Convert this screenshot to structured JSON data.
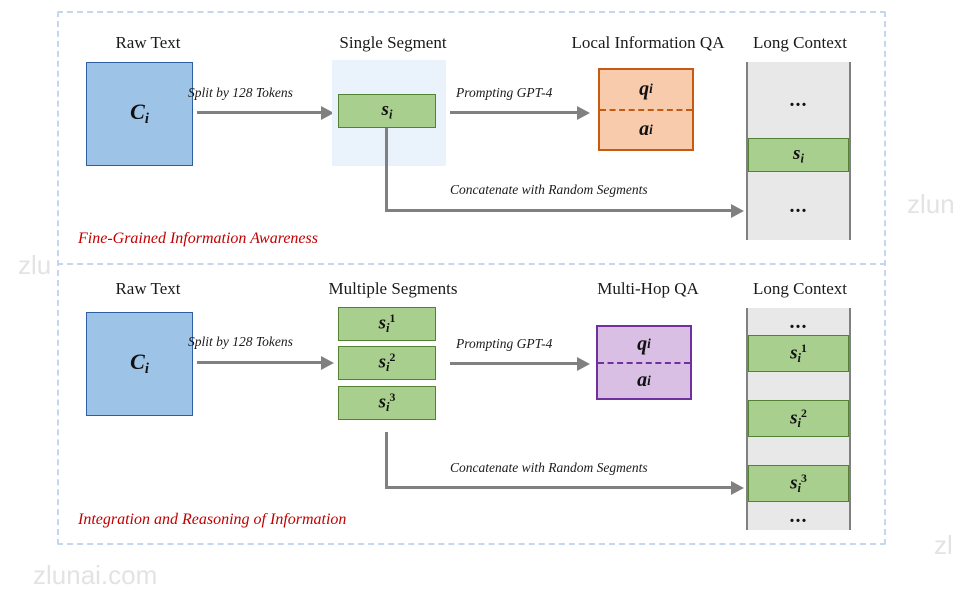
{
  "figure": {
    "panels": [
      {
        "id": "top",
        "caption": "Fine-Grained Information Awareness",
        "columns": {
          "raw_text_title": "Raw Text",
          "segment_title": "Single Segment",
          "qa_title": "Local Information QA",
          "context_title": "Long Context"
        },
        "raw_text_label": "C",
        "raw_text_sub": "i",
        "segments": [
          {
            "base": "s",
            "sub": "i",
            "sup": ""
          }
        ],
        "qa": {
          "question": "q",
          "question_sub": "i",
          "answer": "a",
          "answer_sub": "i",
          "fill": "#f8cbad",
          "stroke": "#c55a11"
        },
        "long_context": [
          {
            "type": "ellipsis",
            "text": "..."
          },
          {
            "type": "segment",
            "base": "s",
            "sub": "i",
            "sup": ""
          },
          {
            "type": "ellipsis",
            "text": "..."
          }
        ],
        "arrows": {
          "split": "Split by 128 Tokens",
          "prompt": "Prompting GPT-4",
          "concat": "Concatenate with Random Segments"
        }
      },
      {
        "id": "bottom",
        "caption": "Integration and Reasoning of Information",
        "columns": {
          "raw_text_title": "Raw Text",
          "segment_title": "Multiple Segments",
          "qa_title": "Multi-Hop QA",
          "context_title": "Long Context"
        },
        "raw_text_label": "C",
        "raw_text_sub": "i",
        "segments": [
          {
            "base": "s",
            "sub": "i",
            "sup": "1"
          },
          {
            "base": "s",
            "sub": "i",
            "sup": "2"
          },
          {
            "base": "s",
            "sub": "i",
            "sup": "3"
          }
        ],
        "qa": {
          "question": "q",
          "question_sub": "i",
          "answer": "a",
          "answer_sub": "i",
          "fill": "#d9bfe4",
          "stroke": "#7030a0"
        },
        "long_context": [
          {
            "type": "ellipsis",
            "text": "..."
          },
          {
            "type": "segment",
            "base": "s",
            "sub": "i",
            "sup": "1"
          },
          {
            "type": "gap"
          },
          {
            "type": "segment",
            "base": "s",
            "sub": "i",
            "sup": "2"
          },
          {
            "type": "gap"
          },
          {
            "type": "segment",
            "base": "s",
            "sub": "i",
            "sup": "3"
          },
          {
            "type": "ellipsis",
            "text": "..."
          }
        ],
        "arrows": {
          "split": "Split by 128 Tokens",
          "prompt": "Prompting GPT-4",
          "concat": "Concatenate with Random Segments"
        }
      }
    ],
    "colors": {
      "raw_text_fill": "#9dc3e6",
      "raw_text_stroke": "#2e5f9e",
      "segment_fill": "#a9cf8f",
      "segment_stroke": "#548235",
      "segment_backdrop": "#eaf2fb",
      "context_fill": "#e8e8e8",
      "context_stroke": "#808080",
      "arrow": "#808080",
      "caption": "#c00000",
      "frame_dash": "#c5d6ef"
    }
  },
  "watermarks": {
    "left": "zlu",
    "right_upper": "zlun",
    "bottom_left": "zlunai.com",
    "bottom_right": "zl"
  }
}
